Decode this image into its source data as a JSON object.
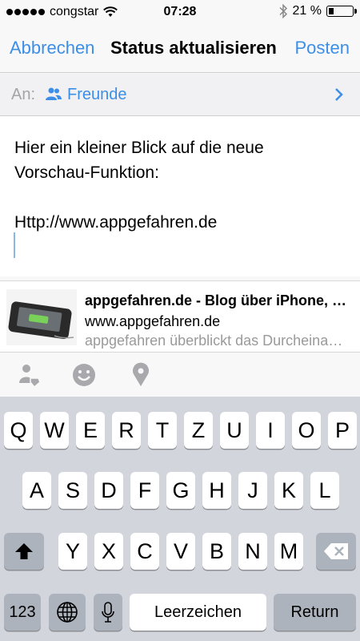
{
  "status_bar": {
    "carrier": "congstar",
    "time": "07:28",
    "battery": "21 %",
    "battery_level": 0.21
  },
  "nav": {
    "cancel": "Abbrechen",
    "title": "Status aktualisieren",
    "post": "Posten"
  },
  "audience": {
    "label": "An:",
    "value": "Freunde"
  },
  "composer": {
    "lines": [
      "Hier ein kleiner Blick auf die neue",
      "Vorschau-Funktion:",
      "",
      "Http://www.appgefahren.de"
    ]
  },
  "link_preview": {
    "title": "appgefahren.de - Blog über iPhone, iPad und Mac",
    "url": "www.appgefahren.de",
    "description": "appgefahren überblickt das Durcheinander"
  },
  "toolbar": {
    "icons": [
      "tag-friends-icon",
      "feeling-icon",
      "location-icon"
    ]
  },
  "keyboard": {
    "row1": [
      "Q",
      "W",
      "E",
      "R",
      "T",
      "Z",
      "U",
      "I",
      "O",
      "P"
    ],
    "row2": [
      "A",
      "S",
      "D",
      "F",
      "G",
      "H",
      "J",
      "K",
      "L"
    ],
    "row3": [
      "Y",
      "X",
      "C",
      "V",
      "B",
      "N",
      "M"
    ],
    "numbers_key": "123",
    "space_key": "Leerzeichen",
    "return_key": "Return"
  },
  "colors": {
    "accent": "#3d8ee6",
    "muted": "#a3a3a8",
    "keyboard_bg": "#d2d5db"
  }
}
